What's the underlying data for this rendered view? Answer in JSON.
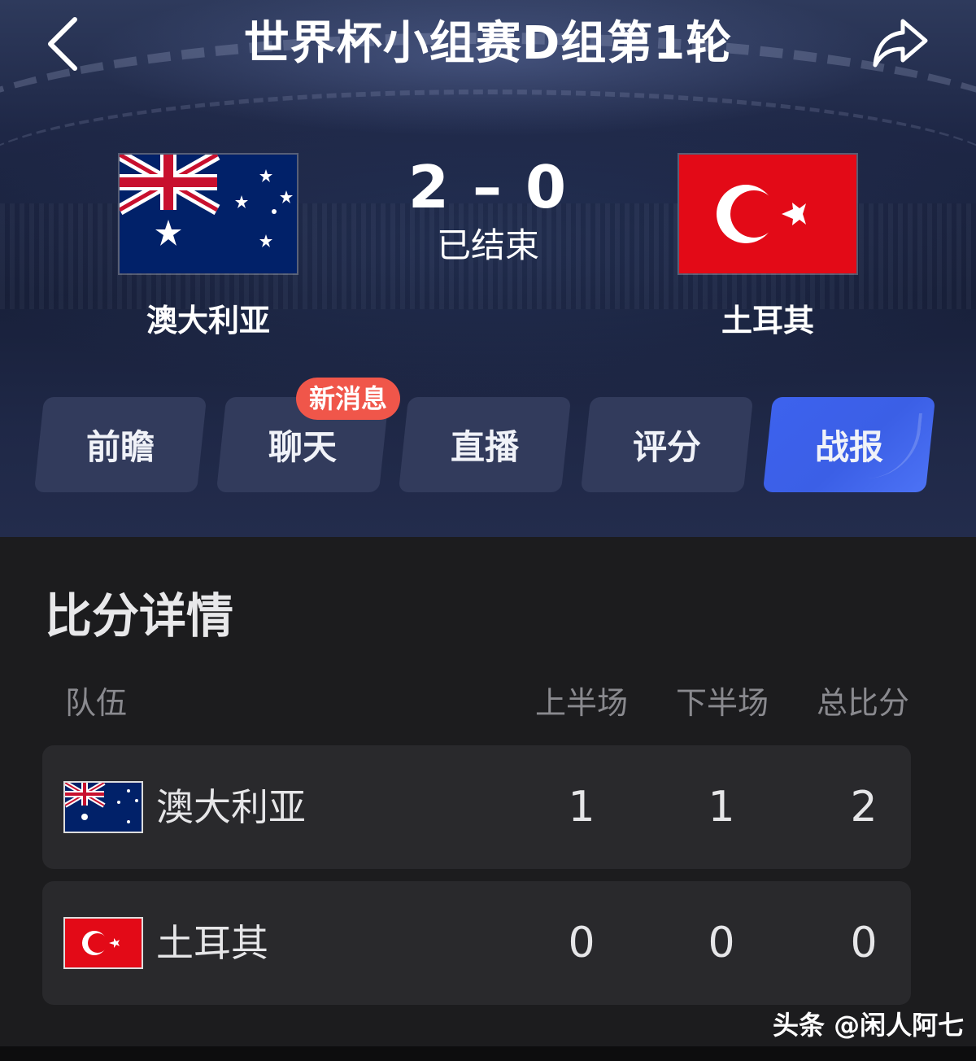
{
  "header": {
    "title": "世界杯小组赛D组第1轮",
    "back_icon": "chevron-left-icon",
    "share_icon": "share-arrow-icon"
  },
  "match": {
    "home_team": "澳大利亚",
    "away_team": "土耳其",
    "score": "2 – 0",
    "status": "已结束"
  },
  "tabs": [
    {
      "label": "前瞻",
      "active": false
    },
    {
      "label": "聊天",
      "active": false,
      "badge": "新消息"
    },
    {
      "label": "直播",
      "active": false
    },
    {
      "label": "评分",
      "active": false
    },
    {
      "label": "战报",
      "active": true
    }
  ],
  "details": {
    "title": "比分详情",
    "columns": [
      "队伍",
      "上半场",
      "下半场",
      "总比分"
    ],
    "rows": [
      {
        "team": "澳大利亚",
        "first_half": "1",
        "second_half": "1",
        "total": "2"
      },
      {
        "team": "土耳其",
        "first_half": "0",
        "second_half": "0",
        "total": "0"
      }
    ]
  },
  "watermark": "头条 @闲人阿七",
  "colors": {
    "accent": "#3d62ee",
    "badge": "#f0564a",
    "background": "#1c1c1e",
    "row_background": "#29292c"
  }
}
